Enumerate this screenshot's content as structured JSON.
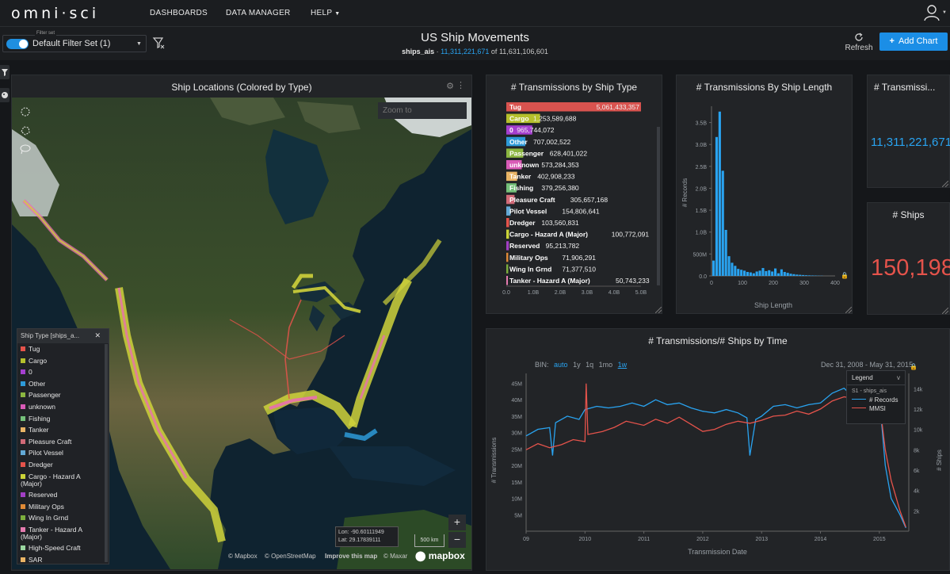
{
  "nav": {
    "logo": "omni·sci",
    "links": [
      "DASHBOARDS",
      "DATA MANAGER",
      "HELP"
    ]
  },
  "filter": {
    "caption": "Filter set",
    "name": "Default Filter Set (1)"
  },
  "dashboard": {
    "title": "US Ship Movements",
    "table": "ships_ais",
    "filtered_count": "11,311,221,671",
    "of_label": "of",
    "total_count": "11,631,106,601",
    "refresh_label": "Refresh",
    "add_chart_label": "Add Chart"
  },
  "map": {
    "title": "Ship Locations (Colored by Type)",
    "zoom_to_placeholder": "Zoom to",
    "legend_title": "Ship Type [ships_a...",
    "legend": [
      {
        "label": "Tug",
        "color": "#e5534b"
      },
      {
        "label": "Cargo",
        "color": "#b5c02c"
      },
      {
        "label": "0",
        "color": "#a53fcf"
      },
      {
        "label": "Other",
        "color": "#2d9ad8"
      },
      {
        "label": "Passenger",
        "color": "#8bb640"
      },
      {
        "label": "unknown",
        "color": "#d95bb7"
      },
      {
        "label": "Fishing",
        "color": "#75c07a"
      },
      {
        "label": "Tanker",
        "color": "#e9b465"
      },
      {
        "label": "Pleasure Craft",
        "color": "#d26a78"
      },
      {
        "label": "Pilot Vessel",
        "color": "#63a9d6"
      },
      {
        "label": "Dredger",
        "color": "#e5534b"
      },
      {
        "label": "Cargo - Hazard A (Major)",
        "color": "#cbd438"
      },
      {
        "label": "Reserved",
        "color": "#a23fc4"
      },
      {
        "label": "Military Ops",
        "color": "#e08a36"
      },
      {
        "label": "Wing In Grnd",
        "color": "#7cae3d"
      },
      {
        "label": "Tanker - Hazard A (Major)",
        "color": "#e57bb0"
      },
      {
        "label": "High-Speed Craft",
        "color": "#9ad6a0"
      },
      {
        "label": "SAR",
        "color": "#e9b465"
      }
    ],
    "coords": {
      "lon": "Lon: -90.60111949",
      "lat": "Lat: 29.17839111"
    },
    "scale_label": "500 km",
    "attribution": [
      "© Mapbox",
      "© OpenStreetMap",
      "Improve this map",
      "© Maxar"
    ],
    "mapbox_logo": "mapbox"
  },
  "charts": {
    "by_type": {
      "title": "# Transmissions by Ship Type"
    },
    "by_length": {
      "title": "# Transmissions By Ship Length",
      "ylabel": "# Records",
      "xlabel": "Ship Length"
    },
    "total": {
      "title": "# Transmissi...",
      "value": "11,311,221,671"
    },
    "ships": {
      "title": "# Ships",
      "value": "150,198"
    },
    "time": {
      "title": "# Transmissions/# Ships by Time",
      "bin_label": "BIN:",
      "bins": [
        "auto",
        "1y",
        "1q",
        "1mo",
        "1w"
      ],
      "date_range": "Dec 31, 2008 - May 31, 2015",
      "legend_title": "Legend",
      "legend_group": "S1 - ships_ais",
      "series_labels": [
        "# Records",
        "MMSI"
      ],
      "ylabel_left": "# Transmissions",
      "ylabel_right": "# Ships",
      "xlabel": "Transmission Date"
    }
  },
  "chart_data": [
    {
      "type": "bar",
      "title": "# Transmissions by Ship Type",
      "orientation": "horizontal",
      "categories": [
        "Tug",
        "Cargo",
        "0",
        "Other",
        "Passenger",
        "unknown",
        "Tanker",
        "Fishing",
        "Pleasure Craft",
        "Pilot Vessel",
        "Dredger",
        "Cargo - Hazard A (Major)",
        "Reserved",
        "Military Ops",
        "Wing In Grnd",
        "Tanker - Hazard A (Major)"
      ],
      "values": [
        5061433357,
        1253589688,
        965744072,
        707002522,
        628401022,
        573284353,
        402908233,
        379256380,
        305657168,
        154806641,
        103560831,
        100772091,
        95213782,
        71906291,
        71377510,
        50743233
      ],
      "value_labels": [
        "5,061,433,357",
        "1,253,589,688",
        "965,744,072",
        "707,002,522",
        "628,401,022",
        "573,284,353",
        "402,908,233",
        "379,256,380",
        "305,657,168",
        "154,806,641",
        "103,560,831",
        "100,772,091",
        "95,213,782",
        "71,906,291",
        "71,377,510",
        "50,743,233"
      ],
      "colors": [
        "#d9534f",
        "#b5c02c",
        "#a53fcf",
        "#2d9ad8",
        "#8bb640",
        "#d95bb7",
        "#e9b465",
        "#75c07a",
        "#d26a78",
        "#63a9d6",
        "#e5534b",
        "#cbd438",
        "#a23fc4",
        "#e08a36",
        "#7cae3d",
        "#e57bb0"
      ],
      "xlim": [
        0,
        5000000000
      ],
      "xticks": [
        "0.0",
        "1.0B",
        "2.0B",
        "3.0B",
        "4.0B",
        "5.0B"
      ]
    },
    {
      "type": "bar",
      "title": "# Transmissions By Ship Length",
      "xlabel": "Ship Length",
      "ylabel": "# Records",
      "ylim": [
        0,
        3800000000
      ],
      "xlim": [
        0,
        400
      ],
      "yticks": [
        "0.0",
        "500M",
        "1.0B",
        "1.5B",
        "2.0B",
        "2.5B",
        "3.0B",
        "3.5B"
      ],
      "xticks": [
        "0",
        "100",
        "200",
        "300",
        "400"
      ],
      "bin_starts": [
        0,
        10,
        20,
        30,
        40,
        50,
        60,
        70,
        80,
        90,
        100,
        110,
        120,
        130,
        140,
        150,
        160,
        170,
        180,
        190,
        200,
        210,
        220,
        230,
        240,
        250,
        260,
        270,
        280,
        290,
        300,
        310,
        320,
        330,
        340,
        350
      ],
      "values": [
        350000000,
        3170000000,
        3750000000,
        2400000000,
        1050000000,
        450000000,
        300000000,
        230000000,
        160000000,
        140000000,
        120000000,
        90000000,
        80000000,
        60000000,
        100000000,
        120000000,
        180000000,
        110000000,
        130000000,
        100000000,
        170000000,
        60000000,
        150000000,
        90000000,
        70000000,
        50000000,
        40000000,
        30000000,
        25000000,
        20000000,
        15000000,
        12000000,
        10000000,
        8000000,
        5000000,
        4000000
      ]
    },
    {
      "type": "line",
      "title": "# Transmissions/# Ships by Time",
      "xlabel": "Transmission Date",
      "ylabel": "# Transmissions",
      "y2label": "# Ships",
      "xlim": [
        2009,
        2015.5
      ],
      "xticks": [
        "09",
        "2010",
        "2011",
        "2012",
        "2013",
        "2014",
        "2015"
      ],
      "ylim": [
        0,
        48000000
      ],
      "yticks": [
        "5M",
        "10M",
        "15M",
        "20M",
        "25M",
        "30M",
        "35M",
        "40M",
        "45M"
      ],
      "y2lim": [
        0,
        15500
      ],
      "y2ticks": [
        "2k",
        "4k",
        "6k",
        "8k",
        "10k",
        "12k",
        "14k"
      ],
      "series": [
        {
          "name": "# Records",
          "color": "#29a3f0",
          "axis": "left",
          "x": [
            2009.0,
            2009.2,
            2009.4,
            2009.45,
            2009.5,
            2009.7,
            2009.9,
            2010.0,
            2010.2,
            2010.4,
            2010.6,
            2010.8,
            2011.0,
            2011.2,
            2011.4,
            2011.6,
            2011.8,
            2012.0,
            2012.2,
            2012.4,
            2012.6,
            2012.75,
            2012.8,
            2012.9,
            2013.0,
            2013.2,
            2013.4,
            2013.6,
            2013.8,
            2014.0,
            2014.2,
            2014.4,
            2014.6,
            2014.8,
            2015.0,
            2015.1,
            2015.2,
            2015.35,
            2015.45
          ],
          "y": [
            29000000,
            31000000,
            31500000,
            23000000,
            33000000,
            35000000,
            34000000,
            37000000,
            38000000,
            37500000,
            38000000,
            39000000,
            38000000,
            40000000,
            38500000,
            39000000,
            37500000,
            36500000,
            36000000,
            37000000,
            36000000,
            34500000,
            23000000,
            34000000,
            35000000,
            38000000,
            38500000,
            37500000,
            38500000,
            39000000,
            42000000,
            43500000,
            40000000,
            44000000,
            41000000,
            20000000,
            10000000,
            5000000,
            1000000
          ]
        },
        {
          "name": "MMSI",
          "color": "#e5534b",
          "axis": "right",
          "x": [
            2009.0,
            2009.2,
            2009.4,
            2009.6,
            2009.8,
            2010.0,
            2010.02,
            2010.05,
            2010.3,
            2010.5,
            2010.7,
            2011.0,
            2011.2,
            2011.4,
            2011.6,
            2011.8,
            2012.0,
            2012.2,
            2012.4,
            2012.6,
            2012.8,
            2013.0,
            2013.2,
            2013.4,
            2013.6,
            2013.8,
            2014.0,
            2014.2,
            2014.4,
            2014.6,
            2014.8,
            2015.0,
            2015.1,
            2015.2,
            2015.35,
            2015.45
          ],
          "y": [
            8000,
            8600,
            8200,
            8500,
            9000,
            8800,
            14500,
            9500,
            9800,
            10200,
            10800,
            10400,
            11000,
            10600,
            11200,
            10500,
            9800,
            10000,
            10500,
            10800,
            10600,
            10900,
            11300,
            11400,
            11800,
            11500,
            12000,
            12800,
            13200,
            13000,
            13400,
            12800,
            8000,
            5000,
            2000,
            400
          ]
        }
      ]
    }
  ]
}
